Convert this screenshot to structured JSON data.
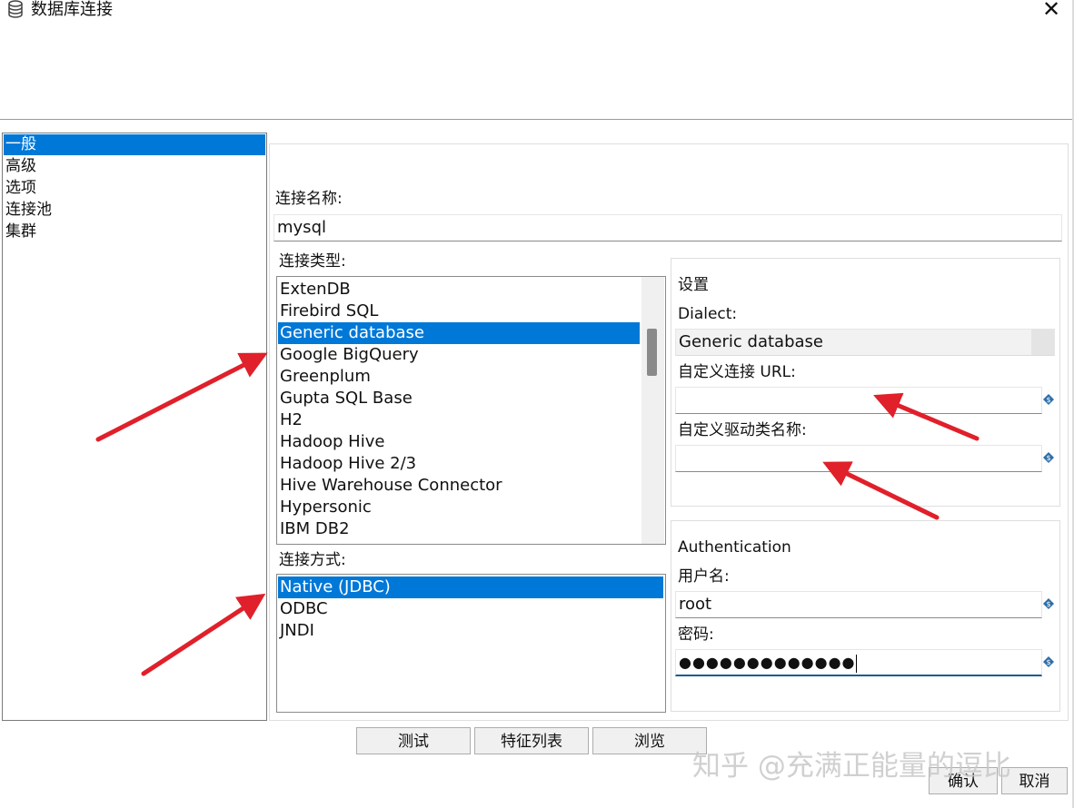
{
  "window": {
    "title": "数据库连接",
    "close_glyph": "✕",
    "icon": "database-icon"
  },
  "nav": {
    "items": [
      {
        "label": "一般",
        "selected": true
      },
      {
        "label": "高级",
        "selected": false
      },
      {
        "label": "选项",
        "selected": false
      },
      {
        "label": "连接池",
        "selected": false
      },
      {
        "label": "集群",
        "selected": false
      }
    ]
  },
  "general": {
    "connection_name_label": "连接名称:",
    "connection_name_value": "mysql",
    "connection_type_label": "连接类型:",
    "connection_types": [
      "ExtenDB",
      "Firebird SQL",
      "Generic database",
      "Google BigQuery",
      "Greenplum",
      "Gupta SQL Base",
      "H2",
      "Hadoop Hive",
      "Hadoop Hive 2/3",
      "Hive Warehouse Connector",
      "Hypersonic",
      "IBM DB2"
    ],
    "connection_type_selected": "Generic database",
    "access_label": "连接方式:",
    "access_methods": [
      "Native (JDBC)",
      "ODBC",
      "JNDI"
    ],
    "access_selected": "Native (JDBC)"
  },
  "settings": {
    "title": "设置",
    "dialect_label": "Dialect:",
    "dialect_value": "Generic database",
    "custom_url_label": "自定义连接 URL:",
    "custom_url_value": "",
    "custom_driver_label": "自定义驱动类名称:",
    "custom_driver_value": ""
  },
  "auth": {
    "title": "Authentication",
    "username_label": "用户名:",
    "username_value": "root",
    "password_label": "密码:",
    "password_mask": "●●●●●●●●●●●●●"
  },
  "buttons": {
    "test": "测试",
    "feature_list": "特征列表",
    "explore": "浏览",
    "ok": "确认",
    "cancel": "取消"
  },
  "watermark": "知乎 @充满正能量的逗比",
  "colors": {
    "selection": "#0078d7",
    "annotation_arrow": "#e0202a"
  }
}
